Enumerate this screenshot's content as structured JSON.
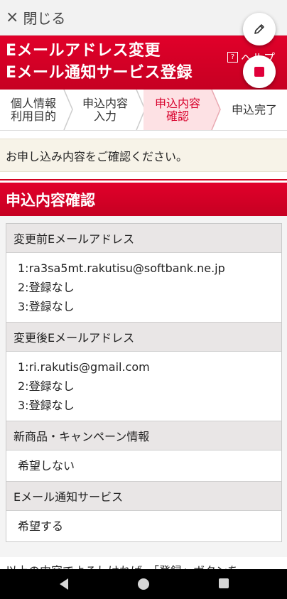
{
  "topbar": {
    "close_icon": "×",
    "close_label": "閉じる"
  },
  "header": {
    "title_line1": "Eメールアドレス変更",
    "title_line2": "Eメール通知サービス登録",
    "help_icon": "?",
    "help_label": "ヘルプ"
  },
  "steps": [
    {
      "label_line1": "個人情報",
      "label_line2": "利用目的",
      "active": false
    },
    {
      "label_line1": "申込内容",
      "label_line2": "入力",
      "active": false
    },
    {
      "label_line1": "申込内容",
      "label_line2": "確認",
      "active": true
    },
    {
      "label_line1": "申込完了",
      "label_line2": "",
      "active": false
    }
  ],
  "notice": "お申し込み内容をご確認ください。",
  "section_title": "申込内容確認",
  "confirm": {
    "before_email": {
      "label": "変更前Eメールアドレス",
      "values": [
        "1:ra3sa5mt.rakutisu@softbank.ne.jp",
        "2:登録なし",
        "3:登録なし"
      ]
    },
    "after_email": {
      "label": "変更後Eメールアドレス",
      "values": [
        "1:ri.rakutis@gmail.com",
        "2:登録なし",
        "3:登録なし"
      ]
    },
    "campaign": {
      "label": "新商品・キャンペーン情報",
      "value": "希望しない"
    },
    "notify": {
      "label": "Eメール通知サービス",
      "value": "希望する"
    }
  },
  "cutoff_text": "以上の内容でよろしければ、「登録」ボタンを",
  "colors": {
    "brand_red": "#d8002b",
    "step_active_bg": "#fde1e4",
    "notice_bg": "#f7f3e8"
  }
}
